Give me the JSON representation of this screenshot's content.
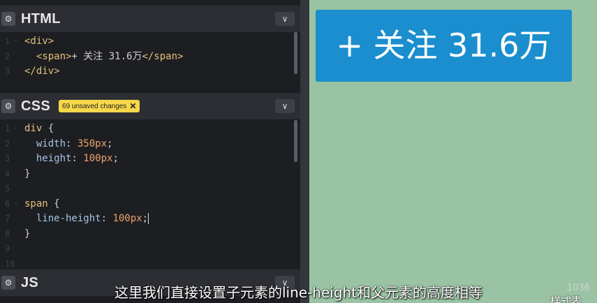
{
  "html_panel": {
    "title": "HTML",
    "lines": [
      {
        "num": "1",
        "fold": "−",
        "parts": [
          {
            "c": "tag",
            "t": "<div>"
          }
        ]
      },
      {
        "num": "2",
        "fold": "",
        "parts": [
          {
            "c": "plain",
            "t": "  "
          },
          {
            "c": "tag",
            "t": "<span>"
          },
          {
            "c": "plain",
            "t": "+ 关注 31.6万"
          },
          {
            "c": "tag",
            "t": "</span>"
          }
        ]
      },
      {
        "num": "3",
        "fold": "",
        "parts": [
          {
            "c": "tag",
            "t": "</div>"
          }
        ]
      }
    ]
  },
  "css_panel": {
    "title": "CSS",
    "badge": "69 unsaved changes",
    "badge_close": "✕",
    "lines": [
      {
        "num": "1",
        "fold": "−",
        "parts": [
          {
            "c": "sel",
            "t": "div"
          },
          {
            "c": "plain",
            "t": " {"
          }
        ]
      },
      {
        "num": "2",
        "fold": "",
        "parts": [
          {
            "c": "plain",
            "t": "  "
          },
          {
            "c": "prop",
            "t": "width"
          },
          {
            "c": "plain",
            "t": ": "
          },
          {
            "c": "val",
            "t": "350px"
          },
          {
            "c": "plain",
            "t": ";"
          }
        ]
      },
      {
        "num": "3",
        "fold": "",
        "parts": [
          {
            "c": "plain",
            "t": "  "
          },
          {
            "c": "prop",
            "t": "height"
          },
          {
            "c": "plain",
            "t": ": "
          },
          {
            "c": "val",
            "t": "100px"
          },
          {
            "c": "plain",
            "t": ";"
          }
        ]
      },
      {
        "num": "4",
        "fold": "",
        "parts": [
          {
            "c": "plain",
            "t": "}"
          }
        ]
      },
      {
        "num": "5",
        "fold": "",
        "parts": []
      },
      {
        "num": "6",
        "fold": "−",
        "parts": [
          {
            "c": "sel",
            "t": "span"
          },
          {
            "c": "plain",
            "t": " {"
          }
        ]
      },
      {
        "num": "7",
        "fold": "",
        "parts": [
          {
            "c": "plain",
            "t": "  "
          },
          {
            "c": "prop",
            "t": "line-height"
          },
          {
            "c": "plain",
            "t": ": "
          },
          {
            "c": "val",
            "t": "100px"
          },
          {
            "c": "plain",
            "t": ";"
          }
        ],
        "cursor": true
      },
      {
        "num": "8",
        "fold": "",
        "parts": [
          {
            "c": "plain",
            "t": "}"
          }
        ]
      },
      {
        "num": "9",
        "fold": "",
        "parts": []
      },
      {
        "num": "10",
        "fold": "",
        "parts": []
      }
    ]
  },
  "js_panel": {
    "title": "JS"
  },
  "preview": {
    "button_text": "+ 关注 31.6万"
  },
  "subtitle": "这里我们直接设置子元素的line-height和父元素的高度相等",
  "watermark": "1036",
  "bottom_text": "样式表",
  "colors": {
    "accent_blue": "#1b8ecf",
    "preview_bg": "#99c3a2",
    "editor_bg": "#1d1e22",
    "badge": "#f8d84a"
  }
}
